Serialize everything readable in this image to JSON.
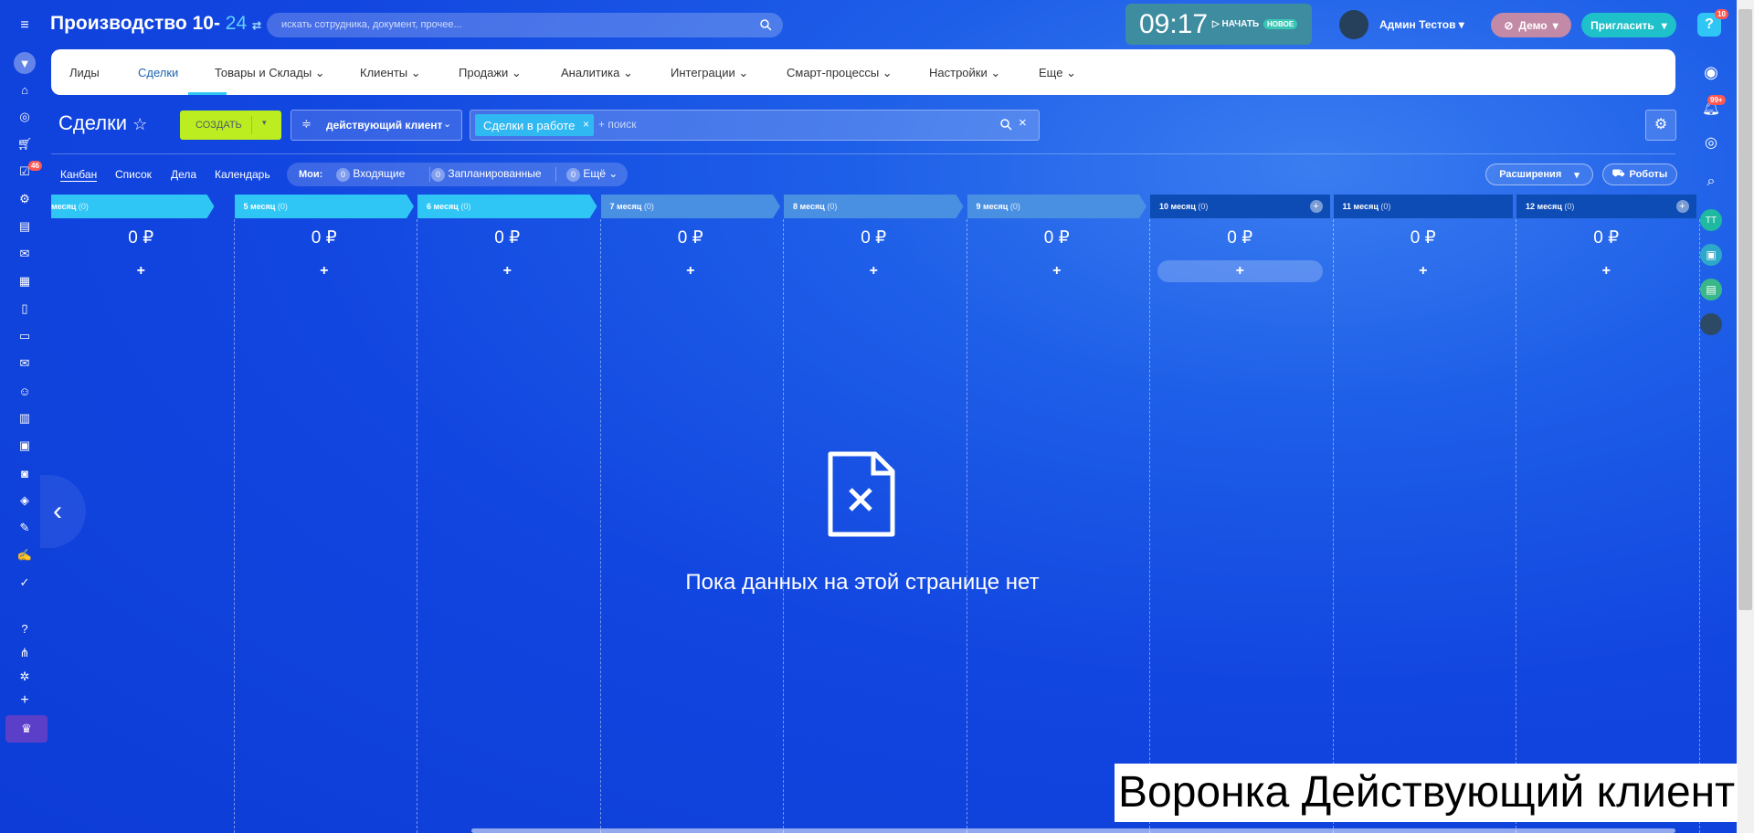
{
  "header": {
    "portal_title": "Производство 10-",
    "portal_num": "24",
    "search_placeholder": "искать сотрудника, документ, прочее...",
    "clock": "09:17",
    "start_label": "НАЧАТЬ",
    "new_badge": "НОВОЕ",
    "user_name": "Админ Тестов",
    "demo_label": "Демо",
    "invite_label": "Пригласить",
    "help_badge": "10"
  },
  "sidebar": {
    "tasks_badge": "46"
  },
  "right_sidebar": {
    "notif_badge": "99+",
    "avatar_initials": "ТТ"
  },
  "menu": {
    "items": [
      "Лиды",
      "Сделки",
      "Товары и Склады",
      "Клиенты",
      "Продажи",
      "Аналитика",
      "Интеграции",
      "Смарт-процессы",
      "Настройки",
      "Еще"
    ],
    "active": "Сделки"
  },
  "toolbar": {
    "page_title": "Сделки",
    "create_label": "СОЗДАТЬ",
    "category_label": "действующий клиент",
    "filter_tag": "Сделки в работе",
    "search_placeholder": "+ поиск"
  },
  "views": {
    "items": [
      "Канбан",
      "Список",
      "Дела",
      "Календарь"
    ],
    "my_label": "Мои:",
    "incoming_count": "0",
    "incoming_label": "Входящие",
    "planned_count": "0",
    "planned_label": "Запланированные",
    "more_count": "0",
    "more_label": "Ещё",
    "extensions_label": "Расширения",
    "robots_label": "Роботы"
  },
  "stages": [
    {
      "name": "месяц",
      "count": "(0)",
      "sum": "0 ₽",
      "color": "#2fc6f6"
    },
    {
      "name": "5 месяц",
      "count": "(0)",
      "sum": "0 ₽",
      "color": "#2fc6f6"
    },
    {
      "name": "6 месяц",
      "count": "(0)",
      "sum": "0 ₽",
      "color": "#2fc6f6"
    },
    {
      "name": "7 месяц",
      "count": "(0)",
      "sum": "0 ₽",
      "color": "#4a90e2"
    },
    {
      "name": "8 месяц",
      "count": "(0)",
      "sum": "0 ₽",
      "color": "#4a90e2"
    },
    {
      "name": "9 месяц",
      "count": "(0)",
      "sum": "0 ₽",
      "color": "#4a90e2"
    },
    {
      "name": "10 месяц",
      "count": "(0)",
      "sum": "0 ₽",
      "color": "#0d4bb5"
    },
    {
      "name": "11 месяц",
      "count": "(0)",
      "sum": "0 ₽",
      "color": "#0d4bb5"
    },
    {
      "name": "12 месяц",
      "count": "(0)",
      "sum": "0 ₽",
      "color": "#0d4bb5"
    }
  ],
  "empty_state": {
    "message": "Пока данных на этой странице нет"
  },
  "watermark": "Воронка Действующий клиент"
}
